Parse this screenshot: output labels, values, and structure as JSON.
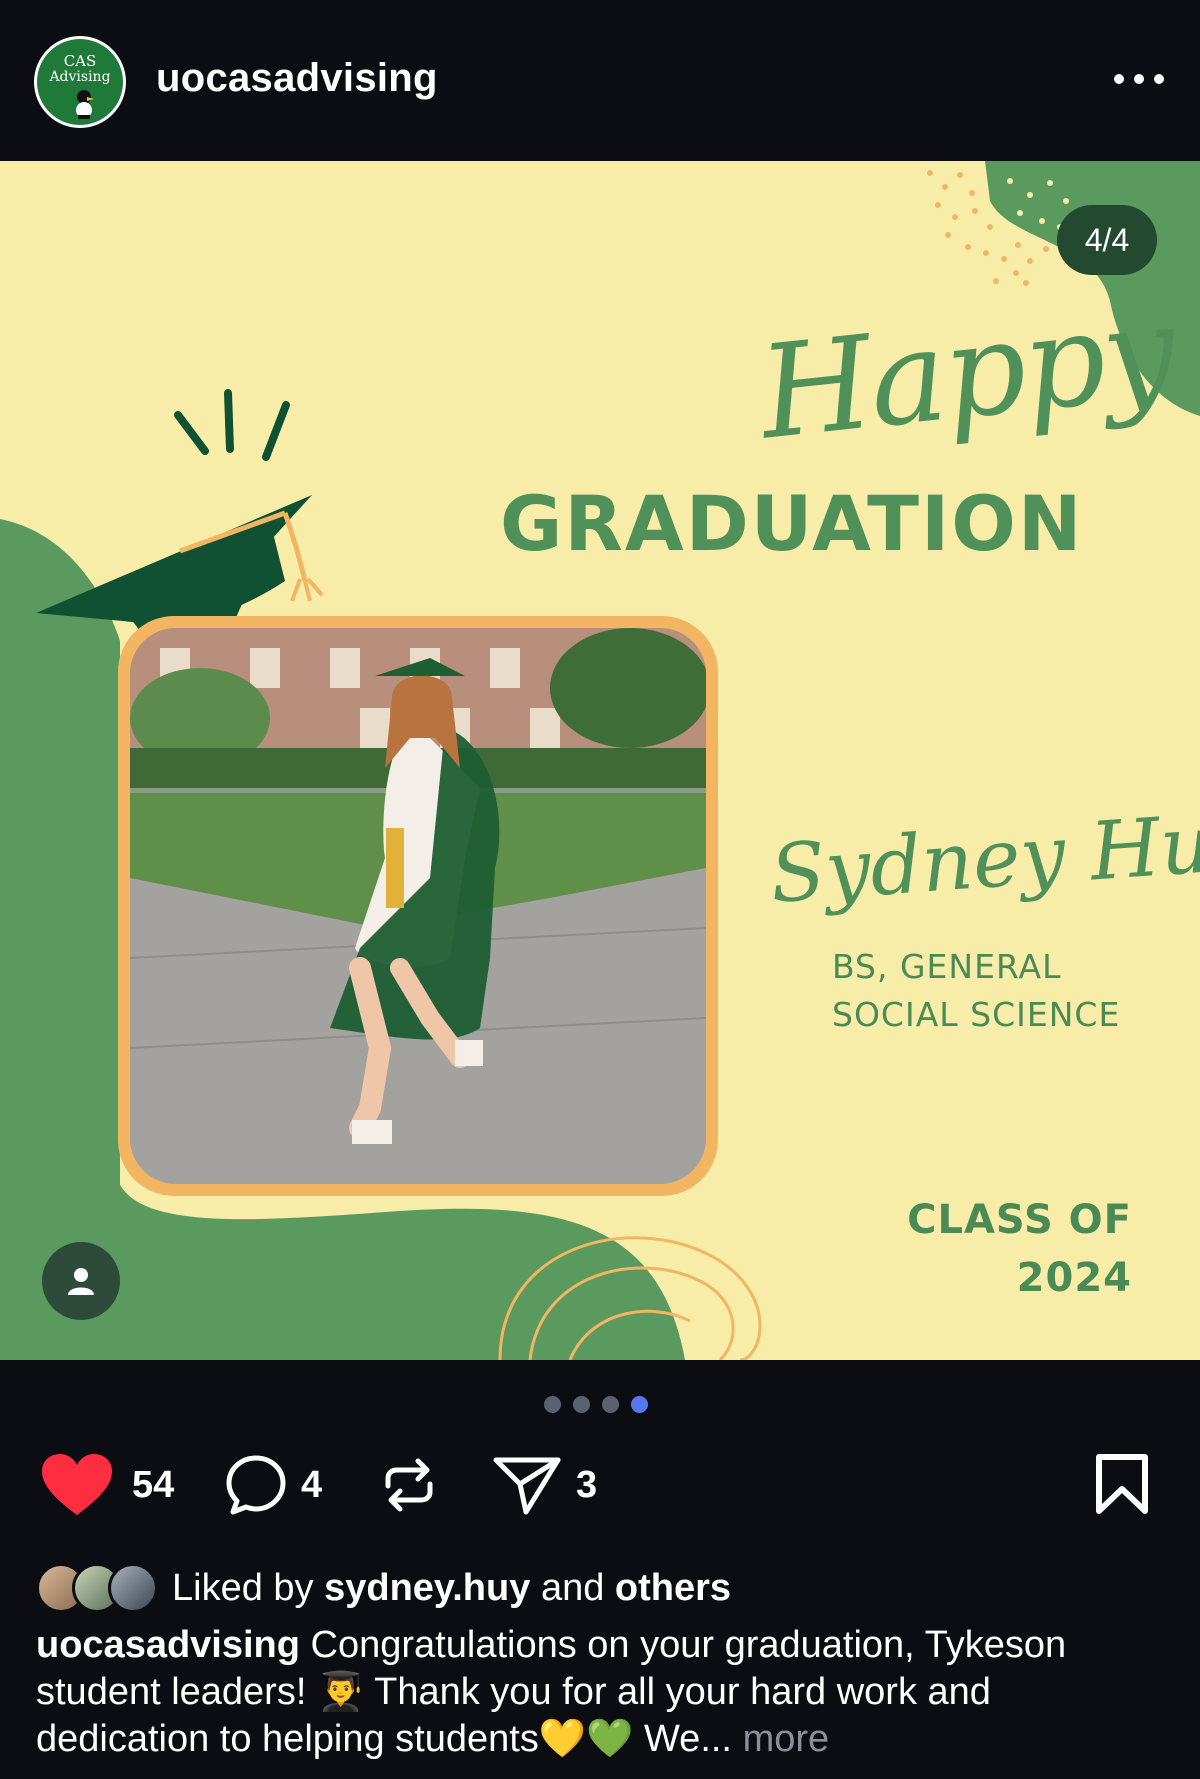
{
  "header": {
    "avatar_text_line1": "CAS",
    "avatar_text_line2": "Advising",
    "username": "uocasadvising",
    "more_icon": "more-horizontal-icon"
  },
  "post": {
    "counter": "4/4",
    "headline_script": "Happy",
    "headline": "GRADUATION",
    "student_name": "Sydney Huy",
    "degree_line1": "BS, GENERAL",
    "degree_line2": "SOCIAL SCIENCE",
    "class_line1": "CLASS OF",
    "class_line2": "2024",
    "colors": {
      "background": "#f7eda9",
      "green": "#4f9158",
      "dark_green": "#0f5132",
      "gold": "#f2b663"
    }
  },
  "pager": {
    "total": 4,
    "active_index": 3
  },
  "actions": {
    "likes": "54",
    "comments": "4",
    "shares": "3",
    "like_color": "#ff2d40"
  },
  "likes": {
    "prefix": "Liked by",
    "user": "sydney.huy",
    "conjunction": "and",
    "others": "others"
  },
  "caption": {
    "username": "uocasadvising",
    "text": "Congratulations on your graduation, Tykeson student leaders! 👨‍🎓 Thank you for all your hard work and dedication to helping students💛💚 We...",
    "more": "more"
  }
}
